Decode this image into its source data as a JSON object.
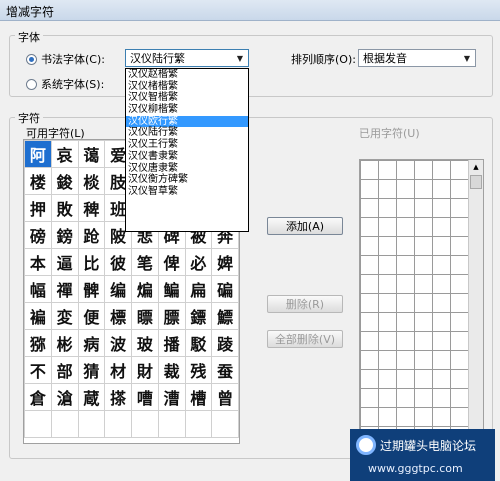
{
  "window": {
    "title": "增减字符"
  },
  "font_group": {
    "legend": "字体",
    "calligraphy_radio_label": "书法字体(C):",
    "system_radio_label": "系统字体(S):",
    "font_combo_value": "汉仪陆行繁",
    "font_options": [
      "汉仪赵楷繁",
      "汉仪楮楷繁",
      "汉仪智楷繁",
      "汉仪柳楷繁",
      "汉仪欧行繁",
      "汉仪陆行繁",
      "汉仪王行繁",
      "汉仪書隶繁",
      "汉仪唐隶繁",
      "汉仪衡方碑繁",
      "汉仪智草繁"
    ],
    "selected_option": "汉仪欧行繁",
    "sort_label": "排列顺序(O):",
    "sort_value": "根据发音"
  },
  "char_group": {
    "legend": "字符",
    "available_label": "可用字符(L)",
    "used_label": "已用字符(U)",
    "available_chars": [
      [
        "阿",
        "哀",
        "蔼",
        "爱",
        "",
        "",
        "",
        ""
      ],
      [
        "楼",
        "鋑",
        "棪",
        "肢",
        "",
        "",
        "",
        ""
      ],
      [
        "押",
        "敗",
        "稗",
        "班",
        "",
        "",
        "",
        ""
      ],
      [
        "磅",
        "鎊",
        "跄",
        "陂",
        "悲",
        "碑",
        "被",
        "奔"
      ],
      [
        "本",
        "逼",
        "比",
        "彼",
        "笔",
        "俾",
        "必",
        "婢"
      ],
      [
        "幅",
        "禪",
        "髀",
        "编",
        "煸",
        "鳊",
        "扁",
        "碥"
      ],
      [
        "褊",
        "変",
        "便",
        "標",
        "瞟",
        "膘",
        "鏢",
        "鰾"
      ],
      [
        "猕",
        "彬",
        "病",
        "波",
        "玻",
        "播",
        "駁",
        "踜"
      ],
      [
        "不",
        "部",
        "猜",
        "材",
        "財",
        "裁",
        "残",
        "蚕"
      ],
      [
        "倉",
        "滄",
        "蔵",
        "搽",
        "嘈",
        "漕",
        "槽",
        "曾"
      ],
      [
        "",
        "",
        "",
        "",
        "",
        "",
        "",
        ""
      ]
    ],
    "add_button": "添加(A)",
    "delete_button": "删除(R)",
    "delete_all_button": "全部删除(V)"
  },
  "watermark": {
    "line1": "过期罐头电脑论坛",
    "line2": "www.gggtpc.com"
  }
}
